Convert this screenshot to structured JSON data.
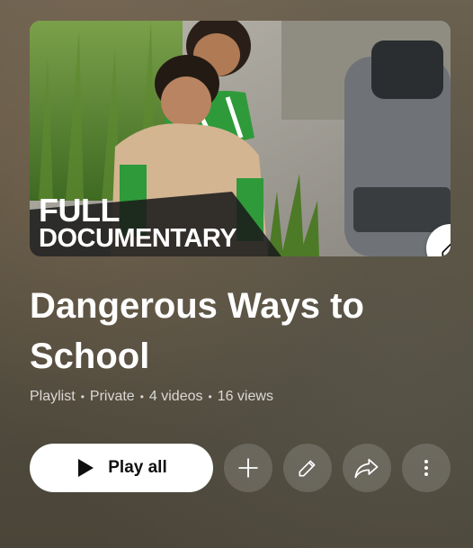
{
  "playlist": {
    "title": "Dangerous Ways to School",
    "meta": [
      "Playlist",
      "Private",
      "4 videos",
      "16 views"
    ]
  },
  "thumbnail": {
    "badge_line1": "FULL",
    "badge_line2": "DOCUMENTARY"
  },
  "actions": {
    "play_all_label": "Play all",
    "icons": [
      "play-icon",
      "add-icon",
      "edit-icon",
      "share-icon",
      "more-vert-icon"
    ]
  },
  "colors": {
    "background": "#5b5444",
    "button_bg": "#ffffff",
    "round_button_bg": "rgba(255,255,255,0.15)",
    "text_primary": "#ffffff"
  }
}
